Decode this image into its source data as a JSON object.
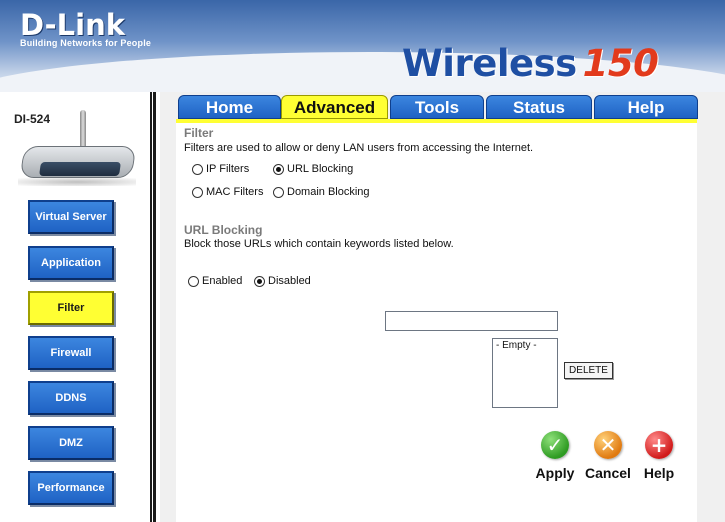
{
  "header": {
    "logo_text": "D-Link",
    "tagline": "Building Networks for People",
    "product_word": "Wireless",
    "product_number": "150"
  },
  "sidebar": {
    "model": "DI-524",
    "items": [
      {
        "label": "Virtual Server"
      },
      {
        "label": "Application"
      },
      {
        "label": "Filter"
      },
      {
        "label": "Firewall"
      },
      {
        "label": "DDNS"
      },
      {
        "label": "DMZ"
      },
      {
        "label": "Performance"
      }
    ],
    "active": "Filter"
  },
  "tabs": [
    {
      "label": "Home"
    },
    {
      "label": "Advanced"
    },
    {
      "label": "Tools"
    },
    {
      "label": "Status"
    },
    {
      "label": "Help"
    }
  ],
  "active_tab": "Advanced",
  "filter": {
    "title": "Filter",
    "description": "Filters are used to allow or deny LAN users from accessing the Internet.",
    "options": {
      "ip": "IP Filters",
      "url": "URL Blocking",
      "mac": "MAC Filters",
      "domain": "Domain Blocking"
    },
    "selected": "URL Blocking"
  },
  "url_blocking": {
    "title": "URL Blocking",
    "description": "Block those URLs which contain keywords listed below.",
    "enabled_label": "Enabled",
    "disabled_label": "Disabled",
    "state": "Disabled",
    "keyword_value": "",
    "list_items": [
      "- Empty -"
    ],
    "delete_label": "DELETE"
  },
  "actions": {
    "apply": "Apply",
    "cancel": "Cancel",
    "help": "Help"
  },
  "colors": {
    "nav_blue": "#1f62c4",
    "active_yellow": "#ffff33"
  }
}
